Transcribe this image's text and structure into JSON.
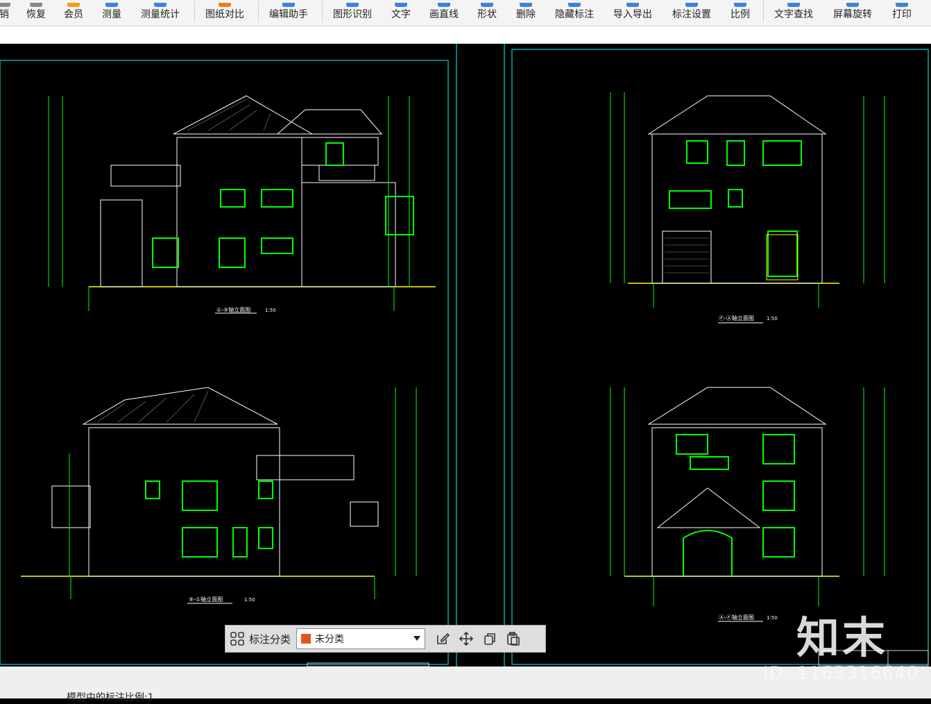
{
  "toolbar": {
    "items": [
      {
        "label": "销",
        "icon": "undo-icon",
        "accent": "#8a8a8a"
      },
      {
        "label": "恢复",
        "icon": "redo-icon",
        "accent": "#8a8a8a"
      },
      {
        "label": "会员",
        "icon": "member-crown-icon",
        "accent": "#f39c12"
      },
      {
        "label": "测量",
        "icon": "measure-icon",
        "accent": "#3c83d9"
      },
      {
        "label": "测量统计",
        "icon": "measure-stat-icon",
        "accent": "#3c83d9"
      },
      {
        "label": "图纸对比",
        "icon": "compare-icon",
        "accent": "#e67e22"
      },
      {
        "label": "编辑助手",
        "icon": "edit-helper-icon",
        "accent": "#3c83d9"
      },
      {
        "label": "图形识别",
        "icon": "shape-recognize-icon",
        "accent": "#3c83d9"
      },
      {
        "label": "文字",
        "icon": "text-icon",
        "accent": "#3c83d9"
      },
      {
        "label": "画直线",
        "icon": "line-icon",
        "accent": "#3c83d9"
      },
      {
        "label": "形状",
        "icon": "shape-icon",
        "accent": "#3c83d9"
      },
      {
        "label": "删除",
        "icon": "delete-icon",
        "accent": "#3c83d9"
      },
      {
        "label": "隐藏标注",
        "icon": "hide-annotation-icon",
        "accent": "#3c83d9"
      },
      {
        "label": "导入导出",
        "icon": "import-export-icon",
        "accent": "#3c83d9"
      },
      {
        "label": "标注设置",
        "icon": "annotation-settings-icon",
        "accent": "#3c83d9"
      },
      {
        "label": "比例",
        "icon": "scale-icon",
        "accent": "#3c83d9"
      },
      {
        "label": "文字查找",
        "icon": "text-search-icon",
        "accent": "#3c83d9"
      },
      {
        "label": "屏幕旋转",
        "icon": "rotate-screen-icon",
        "accent": "#3c83d9"
      },
      {
        "label": "打印",
        "icon": "print-icon",
        "accent": "#3c83d9"
      }
    ]
  },
  "drawing": {
    "view1_title": "①-⑨轴立面图",
    "view2_title": "Ⓕ-Ⓐ轴立面图",
    "view3_title": "⑨-①轴立面图",
    "view4_title": "Ⓐ-Ⓕ轴立面图",
    "scale": "1:50"
  },
  "annotation_panel": {
    "label": "标注分类",
    "selected": "未分类",
    "swatch_color": "#e4541f"
  },
  "status": {
    "text": "模型中的标注比例:1"
  },
  "watermark": {
    "logo": "知末",
    "id": "ID: 1163316640"
  }
}
